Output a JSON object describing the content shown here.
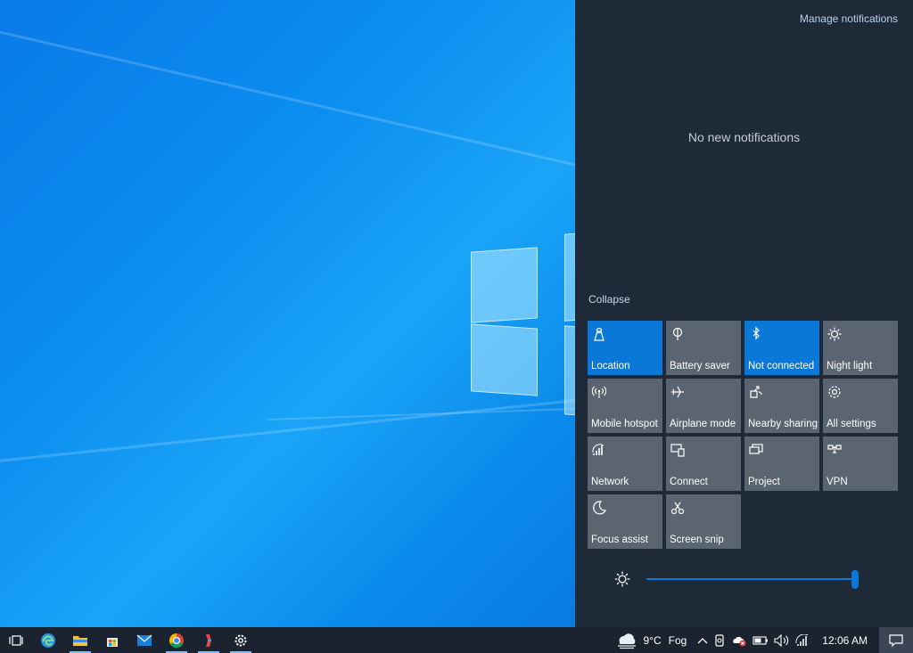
{
  "action_center": {
    "manage_notifications": "Manage notifications",
    "empty_message": "No new notifications",
    "collapse": "Collapse",
    "tiles": [
      {
        "label": "Location",
        "icon": "location-icon",
        "on": true
      },
      {
        "label": "Battery saver",
        "icon": "battery-saver-icon",
        "on": false
      },
      {
        "label": "Not connected",
        "icon": "bluetooth-icon",
        "on": true
      },
      {
        "label": "Night light",
        "icon": "night-light-icon",
        "on": false
      },
      {
        "label": "Mobile hotspot",
        "icon": "mobile-hotspot-icon",
        "on": false
      },
      {
        "label": "Airplane mode",
        "icon": "airplane-icon",
        "on": false
      },
      {
        "label": "Nearby sharing",
        "icon": "nearby-sharing-icon",
        "on": false
      },
      {
        "label": "All settings",
        "icon": "gear-icon",
        "on": false
      },
      {
        "label": "Network",
        "icon": "network-icon",
        "on": false
      },
      {
        "label": "Connect",
        "icon": "connect-icon",
        "on": false
      },
      {
        "label": "Project",
        "icon": "project-icon",
        "on": false
      },
      {
        "label": "VPN",
        "icon": "vpn-icon",
        "on": false
      },
      {
        "label": "Focus assist",
        "icon": "moon-icon",
        "on": false
      },
      {
        "label": "Screen snip",
        "icon": "screen-snip-icon",
        "on": false
      }
    ],
    "brightness_percent": 100
  },
  "taskbar": {
    "apps": [
      {
        "name": "task-view",
        "icon": "task-view-icon"
      },
      {
        "name": "edge",
        "icon": "edge-icon"
      },
      {
        "name": "file-explorer",
        "icon": "folder-icon"
      },
      {
        "name": "store",
        "icon": "store-icon"
      },
      {
        "name": "mail",
        "icon": "mail-icon"
      },
      {
        "name": "chrome",
        "icon": "chrome-icon"
      },
      {
        "name": "app",
        "icon": "app-icon"
      },
      {
        "name": "settings",
        "icon": "gear-icon"
      }
    ],
    "weather": {
      "temp": "9°C",
      "condition": "Fog"
    },
    "clock": "12:06 AM"
  },
  "colors": {
    "accent": "#0a78d7",
    "tile_off": "#5a6571",
    "panel_bg": "#1f2a38",
    "taskbar_bg": "#1b2330"
  }
}
